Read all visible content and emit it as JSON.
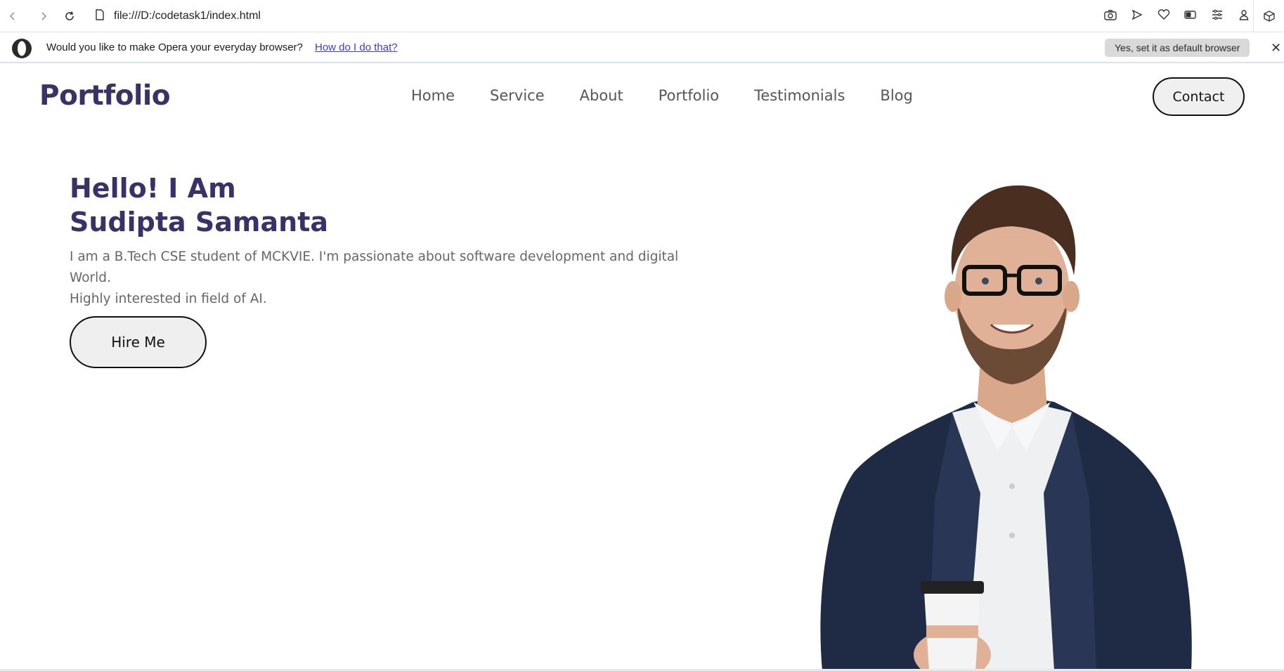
{
  "browser": {
    "url": "file:///D:/codetask1/index.html"
  },
  "opera_prompt": {
    "message": "Would you like to make Opera your everyday browser?",
    "link": "How do I do that?",
    "default_button": "Yes, set it as default browser",
    "close": "✕"
  },
  "site": {
    "logo": "Portfolio",
    "nav": [
      "Home",
      "Service",
      "About",
      "Portfolio",
      "Testimonials",
      "Blog"
    ],
    "contact_button": "Contact",
    "hero": {
      "title_line1": "Hello! I Am",
      "title_line2": "Sudipta Samanta",
      "desc_line1": "I am a B.Tech CSE student of MCKVIE. I'm passionate about software development and digital World.",
      "desc_line2": "Highly interested in field of AI.",
      "hire_button": "Hire Me"
    }
  },
  "colors": {
    "brand": "#3a3266",
    "nav_text": "#555555",
    "body_text": "#666666",
    "link": "#3a3ad6"
  }
}
